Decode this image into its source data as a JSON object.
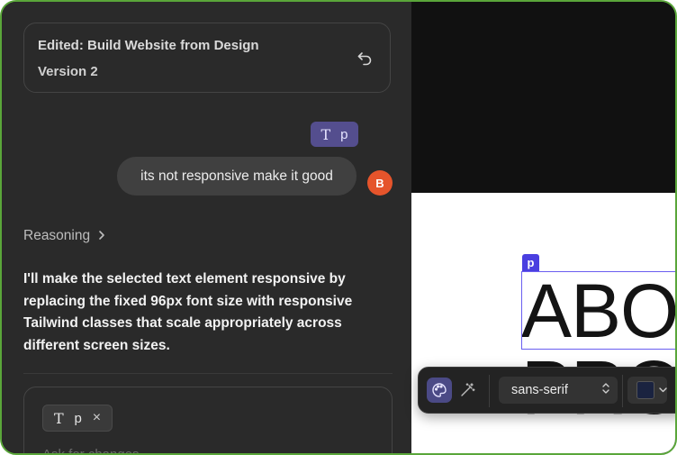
{
  "version_card": {
    "title": "Edited: Build Website from Design",
    "subtitle": "Version 2",
    "undo_icon": "undo-icon"
  },
  "user_message": {
    "chip_type_icon": "T",
    "chip_tag": "p",
    "text": "its not responsive make it good",
    "avatar_initial": "B",
    "avatar_color": "#e5542b"
  },
  "reasoning": {
    "label": "Reasoning",
    "chevron": "›"
  },
  "assistant_message": {
    "text": "I'll make the selected text element responsive by replacing the fixed 96px font size with responsive Tailwind classes that scale appropriately across different screen sizes."
  },
  "composer": {
    "chip_type_icon": "T",
    "chip_tag": "p",
    "chip_remove": "×",
    "placeholder": "Ask for changes..."
  },
  "preview": {
    "element_tag": "p",
    "line1": "ABO",
    "line2": "PRO"
  },
  "toolbar": {
    "font_family": "sans-serif",
    "color_swatch": "#1a2340",
    "accent": "#4b4a86"
  }
}
